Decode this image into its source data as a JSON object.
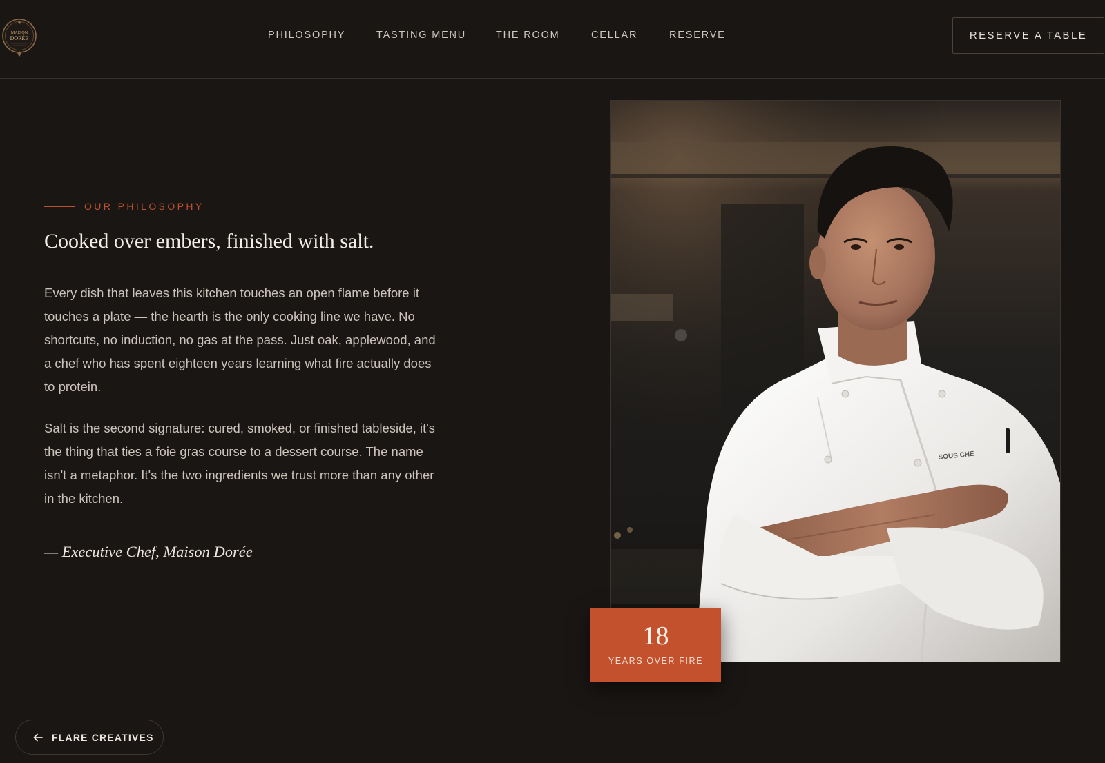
{
  "brand": {
    "name_line1": "MAISON",
    "name_line2": "DORÉE",
    "logo_icon": "maison-doree-seal"
  },
  "nav": {
    "items": [
      {
        "label": "PHILOSOPHY"
      },
      {
        "label": "TASTING MENU"
      },
      {
        "label": "THE ROOM"
      },
      {
        "label": "CELLAR"
      },
      {
        "label": "RESERVE"
      }
    ],
    "cta_label": "RESERVE A TABLE"
  },
  "philosophy": {
    "eyebrow": "OUR PHILOSOPHY",
    "headline": "Cooked over embers, finished with salt.",
    "paragraphs": [
      "Every dish that leaves this kitchen touches an open flame before it touches a plate — the hearth is the only cooking line we have. No shortcuts, no induction, no gas at the pass. Just oak, applewood, and a chef who has spent eighteen years learning what fire actually does to protein.",
      "Salt is the second signature: cured, smoked, or finished tableside, it's the thing that ties a foie gras course to a dessert course. The name isn't a metaphor. It's the two ingredients we trust more than any other in the kitchen."
    ],
    "signature": "— Executive Chef, Maison Dorée"
  },
  "photo": {
    "subject": "chef-portrait",
    "jacket_text": "SOUS CHE"
  },
  "stat": {
    "number": "18",
    "label": "YEARS OVER FIRE"
  },
  "back": {
    "label": "FLARE CREATIVES",
    "icon": "arrow-left-icon"
  },
  "colors": {
    "background": "#1a1614",
    "accent": "#c4512e",
    "text": "#cbc3ba"
  }
}
